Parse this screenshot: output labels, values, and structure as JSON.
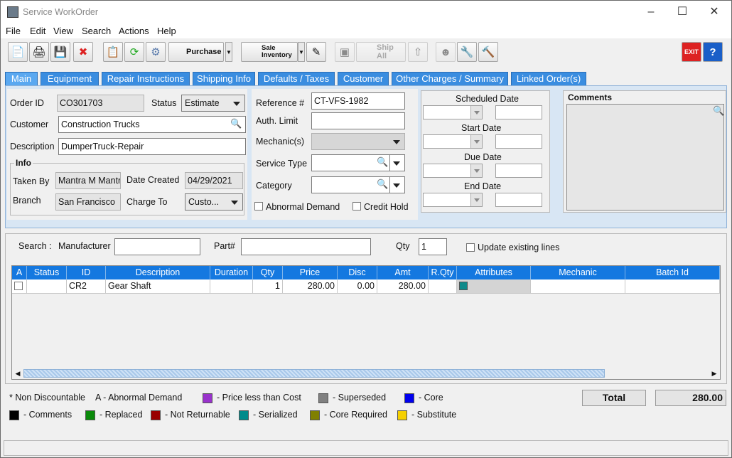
{
  "window": {
    "title": "Service WorkOrder"
  },
  "menu": [
    "File",
    "Edit",
    "View",
    "Search",
    "Actions",
    "Help"
  ],
  "toolbar": {
    "purchase_label": "Purchase",
    "sale_inventory_label": "Sale\nInventory",
    "ship_all_label": "Ship All"
  },
  "tabs": [
    "Main",
    "Equipment",
    "Repair Instructions",
    "Shipping Info",
    "Defaults / Taxes",
    "Customer",
    "Other Charges / Summary",
    "Linked Order(s)"
  ],
  "main": {
    "order_id_label": "Order ID",
    "order_id": "CO301703",
    "status_label": "Status",
    "status": "Estimate",
    "customer_label": "Customer",
    "customer": "Construction Trucks",
    "description_label": "Description",
    "description": "DumperTruck-Repair",
    "info_title": "Info",
    "taken_by_label": "Taken By",
    "taken_by": "Mantra M Mantra",
    "date_created_label": "Date Created",
    "date_created": "04/29/2021",
    "branch_label": "Branch",
    "branch": "San Francisco",
    "charge_to_label": "Charge To",
    "charge_to": "Custo...",
    "reference_label": "Reference #",
    "reference": "CT-VFS-1982",
    "auth_limit_label": "Auth. Limit",
    "auth_limit": "",
    "mechanics_label": "Mechanic(s)",
    "service_type_label": "Service Type",
    "category_label": "Category",
    "abnormal_demand_label": "Abnormal Demand",
    "credit_hold_label": "Credit Hold",
    "scheduled_date_label": "Scheduled Date",
    "start_date_label": "Start Date",
    "due_date_label": "Due Date",
    "end_date_label": "End Date",
    "comments_label": "Comments"
  },
  "search": {
    "search_label": "Search :",
    "manufacturer_label": "Manufacturer",
    "manufacturer": "",
    "part_label": "Part#",
    "part": "",
    "qty_label": "Qty",
    "qty": "1",
    "update_lines_label": "Update existing lines"
  },
  "grid": {
    "columns": [
      "A",
      "Status",
      "ID",
      "Description",
      "Duration",
      "Qty",
      "Price",
      "Disc",
      "Amt",
      "R.Qty",
      "Attributes",
      "Mechanic",
      "Batch Id"
    ],
    "rows": [
      {
        "a": "",
        "status": "",
        "id": "CR2",
        "description": "Gear Shaft",
        "duration": "",
        "qty": "1",
        "price": "280.00",
        "disc": "0.00",
        "amt": "280.00",
        "rqty": "",
        "attr_color": "#0f8a8a",
        "mechanic": "",
        "batch": ""
      }
    ]
  },
  "legend": {
    "non_discountable": "* Non Discountable",
    "abnormal": "A - Abnormal Demand",
    "items": [
      {
        "color": "#9932cc",
        "label": "- Price less than Cost"
      },
      {
        "color": "#808080",
        "label": "- Superseded"
      },
      {
        "color": "#0000ee",
        "label": "- Core"
      },
      {
        "color": "#000000",
        "label": "- Comments"
      },
      {
        "color": "#0a8a0a",
        "label": "- Replaced"
      },
      {
        "color": "#990000",
        "label": "- Not Returnable"
      },
      {
        "color": "#008b8b",
        "label": "- Serialized"
      },
      {
        "color": "#808000",
        "label": "- Core Required"
      },
      {
        "color": "#f5d000",
        "label": "- Substitute"
      }
    ]
  },
  "totals": {
    "total_label": "Total",
    "total_value": "280.00"
  }
}
